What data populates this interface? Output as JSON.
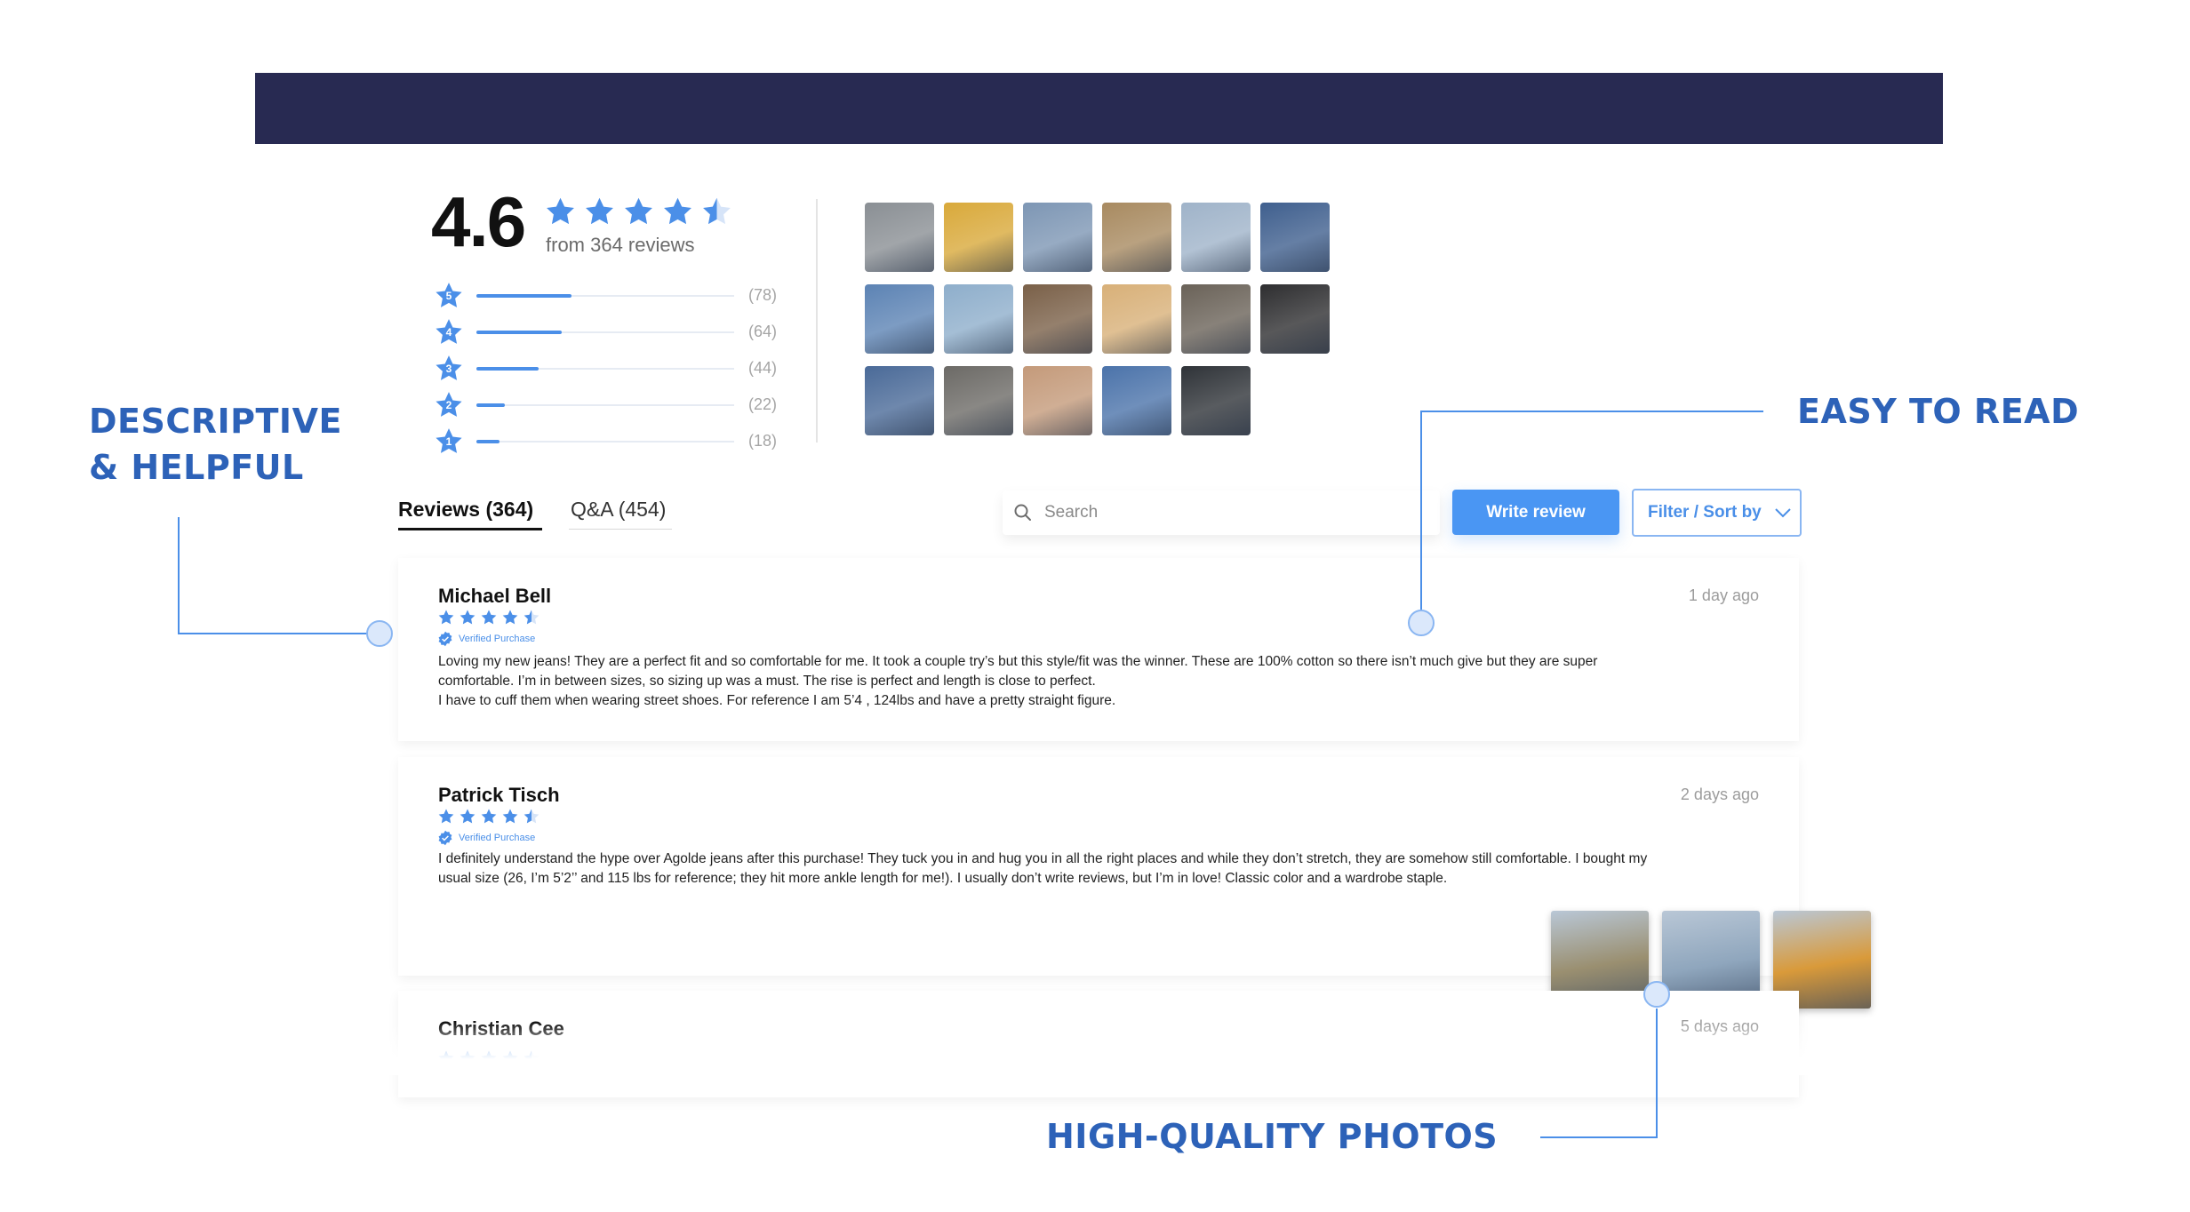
{
  "summary": {
    "score": "4.6",
    "score_stars": 4.5,
    "review_count_text": "from 364 reviews",
    "breakdown": [
      {
        "stars": "5",
        "count": "(78)",
        "fraction": 0.37
      },
      {
        "stars": "4",
        "count": "(64)",
        "fraction": 0.33
      },
      {
        "stars": "3",
        "count": "(44)",
        "fraction": 0.24
      },
      {
        "stars": "2",
        "count": "(22)",
        "fraction": 0.11
      },
      {
        "stars": "1",
        "count": "(18)",
        "fraction": 0.09
      }
    ]
  },
  "gallery": {
    "row_counts": [
      6,
      6,
      5
    ],
    "tones": [
      [
        "#8a8f94",
        "#d9a93a",
        "#7d96b4",
        "#a88a60",
        "#9fb3c9",
        "#3f5f8e"
      ],
      [
        "#5c83b4",
        "#8eaecb",
        "#7a6048",
        "#d8b078",
        "#6a6258",
        "#2e2e30"
      ],
      [
        "#4a6a98",
        "#6c6a66",
        "#c49a7a",
        "#4b73aa",
        "#2f3338"
      ]
    ]
  },
  "tabs": {
    "reviews": "Reviews (364)",
    "qa": "Q&A (454)"
  },
  "search": {
    "placeholder": "Search"
  },
  "actions": {
    "write_review": "Write review",
    "filter_sort": "Filter / Sort by"
  },
  "verified_label": "Verified Purchase",
  "reviews": [
    {
      "name": "Michael Bell",
      "date": "1 day ago",
      "rating": 4.5,
      "lines": [
        "Loving my new jeans! They are a perfect fit and so comfortable for me. It took a couple try’s but this style/fit was the winner. These are 100% cotton so there isn’t much give but they are super",
        "comfortable. I’m in between sizes, so sizing up was a must. The rise is perfect and length is close to perfect.",
        "I have to cuff them when wearing street shoes.  For reference I am 5’4 , 124lbs and have a pretty straight figure."
      ]
    },
    {
      "name": "Patrick Tisch",
      "date": "2 days ago",
      "rating": 4.5,
      "lines": [
        "I definitely understand the hype over Agolde jeans after this purchase! They tuck you in and hug you in all the right places and while they don’t stretch, they are somehow still comfortable. I bought my",
        "usual size (26, I’m 5’2’’ and 115 lbs for reference; they hit more ankle length for me!). I usually don’t write reviews, but I’m in love! Classic color and a wardrobe staple."
      ],
      "photo_tones": [
        "#9a8f70",
        "#8fa6bd",
        "#d99a3a"
      ]
    },
    {
      "name": "Christian Cee",
      "date": "5 days ago",
      "rating": 4.5
    }
  ],
  "callouts": {
    "descriptive_line1": "DESCRIPTIVE",
    "descriptive_line2": "& HELPFUL",
    "easy": "EASY TO READ",
    "photos": "HIGH-QUALITY PHOTOS"
  },
  "colors": {
    "header_bar": "#282a52",
    "accent": "#4a96f3",
    "callout": "#2d62b8"
  }
}
